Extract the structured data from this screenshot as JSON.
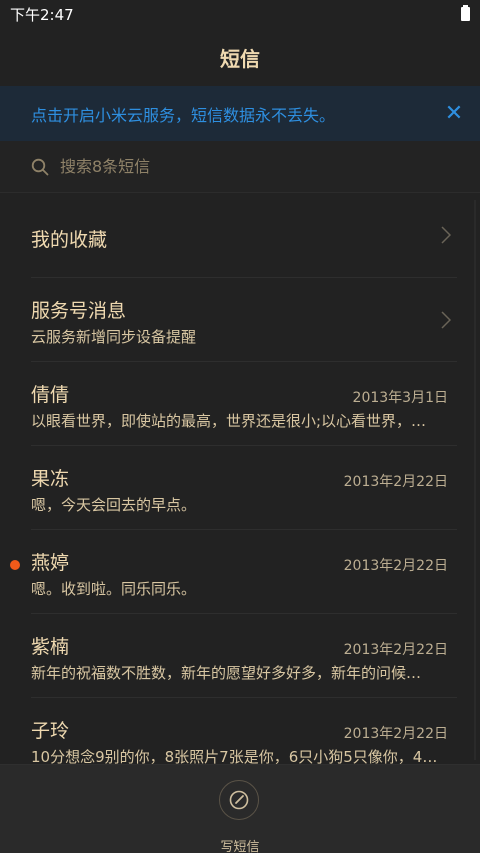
{
  "status": {
    "time": "下午2:47"
  },
  "header": {
    "title": "短信"
  },
  "banner": {
    "text": "点击开启小米云服务，短信数据永不丢失。",
    "close": "✕"
  },
  "search": {
    "placeholder": "搜索8条短信"
  },
  "rows": [
    {
      "title": "我的收藏"
    },
    {
      "title": "服务号消息",
      "sub": "云服务新增同步设备提醒"
    },
    {
      "title": "倩倩",
      "date": "2013年3月1日",
      "sub": "以眼看世界，即使站的最高，世界还是很小;以心看世界，…"
    },
    {
      "title": "果冻",
      "date": "2013年2月22日",
      "sub": "嗯，今天会回去的早点。"
    },
    {
      "title": "燕婷",
      "date": "2013年2月22日",
      "sub": "嗯。收到啦。同乐同乐。",
      "unread": true
    },
    {
      "title": "紫楠",
      "date": "2013年2月22日",
      "sub": "新年的祝福数不胜数，新年的愿望好多好多，新年的问候…"
    },
    {
      "title": "子玲",
      "date": "2013年2月22日",
      "sub": "10分想念9别的你，8张照片7张是你，6只小狗5只像你，4…"
    }
  ],
  "bottom": {
    "compose_label": "写短信"
  },
  "colors": {
    "accent": "#2e8fe0",
    "unread": "#f05a1a",
    "text": "#efd9b0"
  }
}
